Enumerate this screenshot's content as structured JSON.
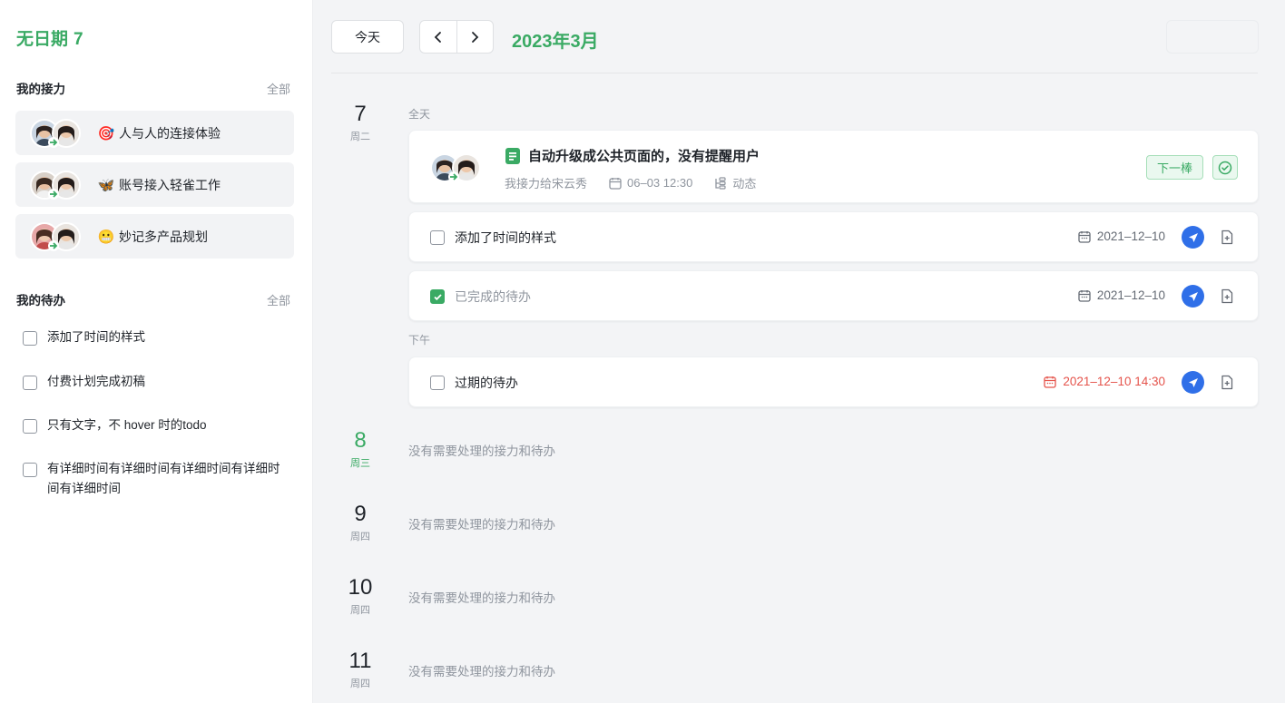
{
  "sidebar": {
    "title": "无日期",
    "title_count": "7",
    "relay_section": {
      "heading": "我的接力",
      "all_link": "全部"
    },
    "relays": [
      {
        "emoji": "🎯",
        "label": "人与人的连接体验"
      },
      {
        "emoji": "🦋",
        "label": "账号接入轻雀工作"
      },
      {
        "emoji": "😬",
        "label": "妙记多产品规划"
      }
    ],
    "todo_section": {
      "heading": "我的待办",
      "all_link": "全部"
    },
    "todos": [
      {
        "label": "添加了时间的样式"
      },
      {
        "label": "付费计划完成初稿"
      },
      {
        "label": "只有文字，不 hover 时的todo"
      },
      {
        "label": "有详细时间有详细时间有详细时间有详细时间有详细时间"
      }
    ]
  },
  "toolbar": {
    "today_label": "今天",
    "prev_icon": "chevron-left-icon",
    "next_icon": "chevron-right-icon",
    "month_title": "2023年3月"
  },
  "days": [
    {
      "num": "7",
      "weekday": "周二"
    },
    {
      "num": "8",
      "weekday": "周三"
    },
    {
      "num": "9",
      "weekday": "周四"
    },
    {
      "num": "10",
      "weekday": "周四"
    },
    {
      "num": "11",
      "weekday": "周四"
    }
  ],
  "day7": {
    "allday_label": "全天",
    "afternoon_label": "下午",
    "relay_card": {
      "title": "自动升级成公共页面的，没有提醒用户",
      "handed_to": "我接力给宋云秀",
      "time": "06–03 12:30",
      "activity": "动态",
      "next_button": "下一棒"
    },
    "todos": [
      {
        "label": "添加了时间的样式",
        "date": "2021–12–10",
        "done": false
      },
      {
        "label": "已完成的待办",
        "date": "2021–12–10",
        "done": true
      }
    ],
    "afternoon_todo": {
      "label": "过期的待办",
      "date": "2021–12–10 14:30",
      "overdue": true
    }
  },
  "empty_message": "没有需要处理的接力和待办",
  "colors": {
    "accent": "#3aaa64",
    "overdue": "#e5534b",
    "plane_blue": "#2f6fe8"
  }
}
